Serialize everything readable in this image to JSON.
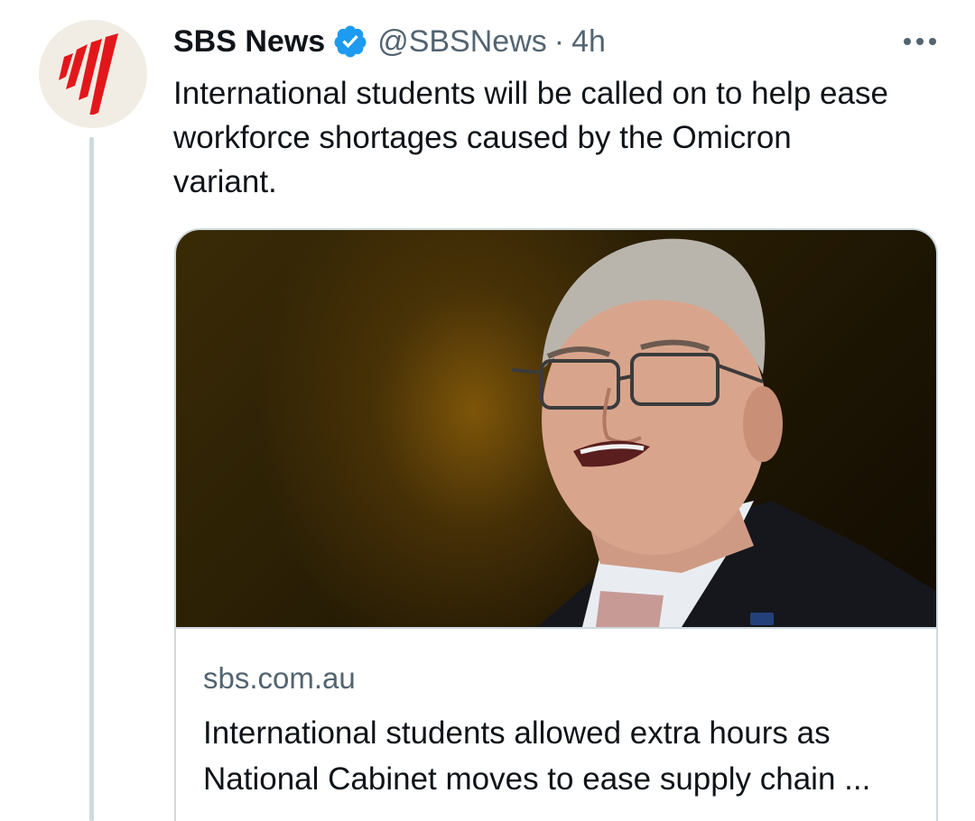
{
  "author": {
    "display_name": "SBS News",
    "handle": "@SBSNews",
    "separator": "·",
    "time": "4h",
    "verified": true,
    "avatar_icon": "sbs-logo-icon",
    "brand_color": "#e3171b"
  },
  "tweet": {
    "text_lines": [
      "International students will be called on to help ease",
      "workforce shortages caused by the Omicron",
      "variant."
    ]
  },
  "card": {
    "domain": "sbs.com.au",
    "title_lines": [
      "International students allowed extra hours as",
      "National Cabinet moves to ease supply chain ..."
    ]
  },
  "icons": {
    "verified": "verified-badge-icon",
    "more": "more-options-icon"
  },
  "colors": {
    "verified_blue": "#1d9bf0",
    "secondary_text": "#536471",
    "border": "#cfd9de"
  }
}
